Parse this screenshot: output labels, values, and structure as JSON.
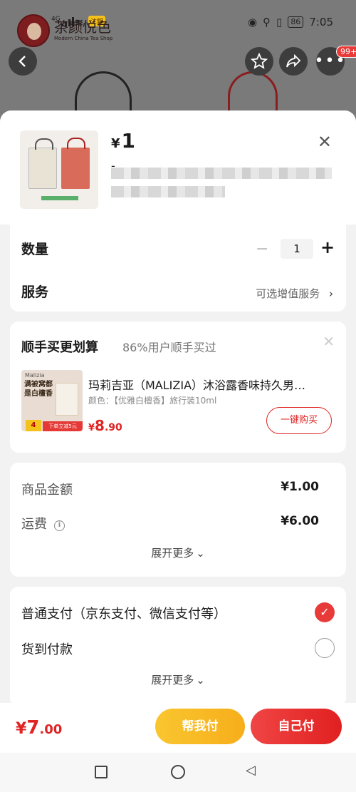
{
  "status_bar": {
    "network": "4G",
    "flash_badge": "注解",
    "time": "7:05",
    "battery": "86",
    "brand_logo_text": "茶颜悦色",
    "brand_logo_sub": "Modern China Tea Shop"
  },
  "nav": {
    "more_badge": "99+"
  },
  "product": {
    "currency": "¥",
    "price": "1",
    "dash": "-"
  },
  "quantity": {
    "label": "数量",
    "value": "1",
    "minus": "−",
    "plus": "+"
  },
  "service": {
    "label": "服务",
    "value": "可选增值服务"
  },
  "bundle": {
    "title": "顺手买更划算",
    "subtitle": "86%用户顺手买过",
    "item_name": "玛莉吉亚（MALIZIA）沐浴露香味持久男…",
    "item_spec": "颜色：【优雅白檀香】旅行装10ml",
    "price_currency": "¥",
    "price_int": "8",
    "price_dec": ".90",
    "buy_label": "一键购买",
    "img_brand": "Malizia",
    "img_text": "满被窝都是白檀香",
    "img_tag": "下单立减5元",
    "img_num": "4"
  },
  "fees": {
    "goods_label": "商品金额",
    "goods_value": "¥1.00",
    "shipping_label": "运费",
    "shipping_value": "¥6.00",
    "expand_label": "展开更多"
  },
  "payment": {
    "option1": "普通支付（京东支付、微信支付等）",
    "option2": "货到付款",
    "expand_label": "展开更多"
  },
  "checkout": {
    "currency": "¥",
    "total_int": "7",
    "total_dec": ".00",
    "help_pay": "帮我付",
    "self_pay": "自己付"
  },
  "colors": {
    "accent_red": "#e02424",
    "help_yellow": "#f7ae1b"
  }
}
